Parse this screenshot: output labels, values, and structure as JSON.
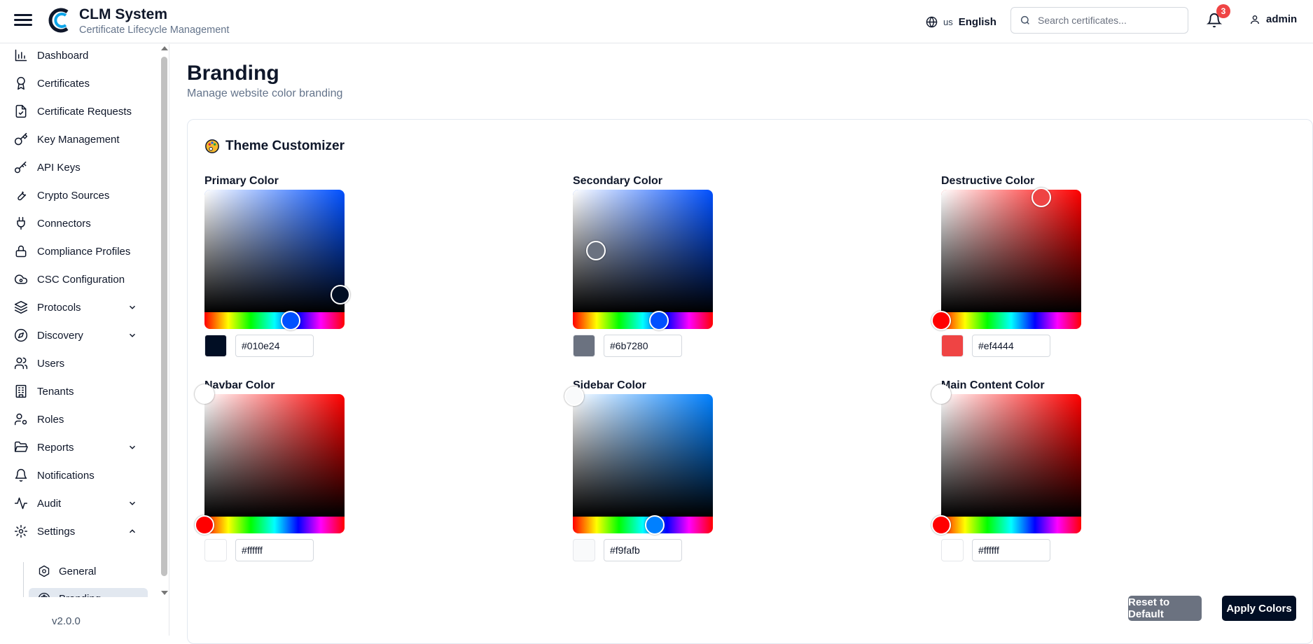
{
  "header": {
    "app_title": "CLM System",
    "app_subtitle": "Certificate Lifecycle Management",
    "language_code": "us",
    "language_name": "English",
    "search_placeholder": "Search certificates...",
    "notification_count": "3",
    "user_name": "admin"
  },
  "sidebar": {
    "items": [
      {
        "label": "Dashboard",
        "icon": "bar-chart-icon"
      },
      {
        "label": "Certificates",
        "icon": "award-icon"
      },
      {
        "label": "Certificate Requests",
        "icon": "file-check-icon"
      },
      {
        "label": "Key Management",
        "icon": "key-icon"
      },
      {
        "label": "API Keys",
        "icon": "key-round-icon"
      },
      {
        "label": "Crypto Sources",
        "icon": "wrench-icon"
      },
      {
        "label": "Connectors",
        "icon": "plug-icon"
      },
      {
        "label": "Compliance Profiles",
        "icon": "lock-icon"
      },
      {
        "label": "CSC Configuration",
        "icon": "cloud-cog-icon"
      },
      {
        "label": "Protocols",
        "icon": "layers-icon",
        "expandable": true
      },
      {
        "label": "Discovery",
        "icon": "compass-icon",
        "expandable": true
      },
      {
        "label": "Users",
        "icon": "users-icon"
      },
      {
        "label": "Tenants",
        "icon": "building-icon"
      },
      {
        "label": "Roles",
        "icon": "user-cog-icon"
      },
      {
        "label": "Reports",
        "icon": "folder-open-icon",
        "expandable": true
      },
      {
        "label": "Notifications",
        "icon": "bell-icon"
      },
      {
        "label": "Audit",
        "icon": "activity-icon",
        "expandable": true
      },
      {
        "label": "Settings",
        "icon": "gear-icon",
        "expanded": true
      }
    ],
    "sub_items": [
      {
        "label": "General",
        "icon": "cog-icon"
      },
      {
        "label": "Branding",
        "icon": "palette-icon",
        "active": true
      }
    ],
    "version": "v2.0.0"
  },
  "main": {
    "title": "Branding",
    "subtitle": "Manage website color branding",
    "card_title": "Theme Customizer",
    "pickers": [
      {
        "label": "Primary Color",
        "value": "#010e24",
        "hue_color": "#0050ff"
      },
      {
        "label": "Secondary Color",
        "value": "#6b7280",
        "hue_color": "#0050ff"
      },
      {
        "label": "Destructive Color",
        "value": "#ef4444",
        "hue_color": "#ff0000"
      },
      {
        "label": "Navbar Color",
        "value": "#ffffff",
        "hue_color": "#ff0000"
      },
      {
        "label": "Sidebar Color",
        "value": "#f9fafb",
        "hue_color": "#0080ff"
      },
      {
        "label": "Main Content Color",
        "value": "#ffffff",
        "hue_color": "#ff0000"
      }
    ],
    "reset_label": "Reset to Default",
    "apply_label": "Apply Colors"
  }
}
